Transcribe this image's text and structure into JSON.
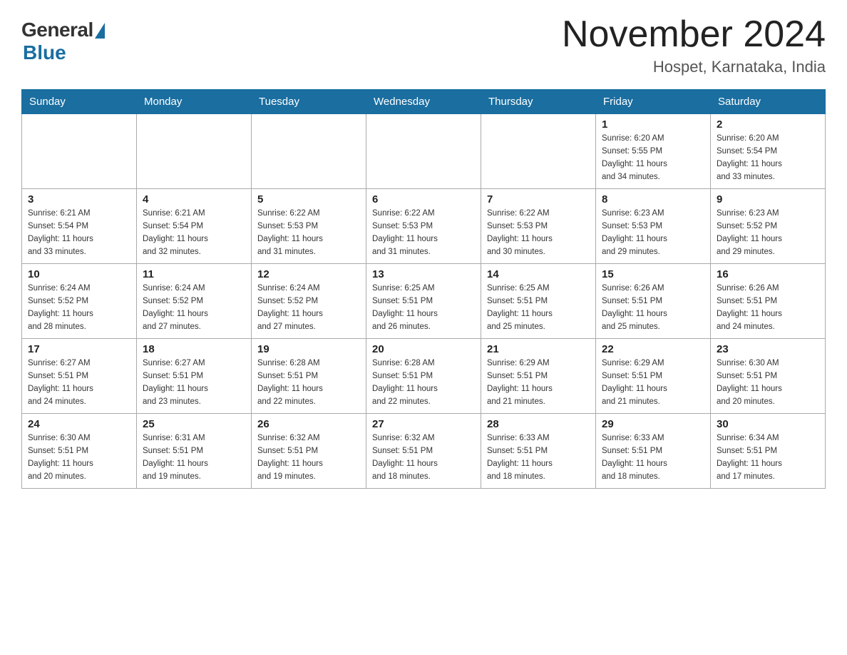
{
  "header": {
    "logo_general": "General",
    "logo_blue": "Blue",
    "month_title": "November 2024",
    "location": "Hospet, Karnataka, India"
  },
  "weekdays": [
    "Sunday",
    "Monday",
    "Tuesday",
    "Wednesday",
    "Thursday",
    "Friday",
    "Saturday"
  ],
  "weeks": [
    [
      {
        "day": "",
        "info": ""
      },
      {
        "day": "",
        "info": ""
      },
      {
        "day": "",
        "info": ""
      },
      {
        "day": "",
        "info": ""
      },
      {
        "day": "",
        "info": ""
      },
      {
        "day": "1",
        "info": "Sunrise: 6:20 AM\nSunset: 5:55 PM\nDaylight: 11 hours\nand 34 minutes."
      },
      {
        "day": "2",
        "info": "Sunrise: 6:20 AM\nSunset: 5:54 PM\nDaylight: 11 hours\nand 33 minutes."
      }
    ],
    [
      {
        "day": "3",
        "info": "Sunrise: 6:21 AM\nSunset: 5:54 PM\nDaylight: 11 hours\nand 33 minutes."
      },
      {
        "day": "4",
        "info": "Sunrise: 6:21 AM\nSunset: 5:54 PM\nDaylight: 11 hours\nand 32 minutes."
      },
      {
        "day": "5",
        "info": "Sunrise: 6:22 AM\nSunset: 5:53 PM\nDaylight: 11 hours\nand 31 minutes."
      },
      {
        "day": "6",
        "info": "Sunrise: 6:22 AM\nSunset: 5:53 PM\nDaylight: 11 hours\nand 31 minutes."
      },
      {
        "day": "7",
        "info": "Sunrise: 6:22 AM\nSunset: 5:53 PM\nDaylight: 11 hours\nand 30 minutes."
      },
      {
        "day": "8",
        "info": "Sunrise: 6:23 AM\nSunset: 5:53 PM\nDaylight: 11 hours\nand 29 minutes."
      },
      {
        "day": "9",
        "info": "Sunrise: 6:23 AM\nSunset: 5:52 PM\nDaylight: 11 hours\nand 29 minutes."
      }
    ],
    [
      {
        "day": "10",
        "info": "Sunrise: 6:24 AM\nSunset: 5:52 PM\nDaylight: 11 hours\nand 28 minutes."
      },
      {
        "day": "11",
        "info": "Sunrise: 6:24 AM\nSunset: 5:52 PM\nDaylight: 11 hours\nand 27 minutes."
      },
      {
        "day": "12",
        "info": "Sunrise: 6:24 AM\nSunset: 5:52 PM\nDaylight: 11 hours\nand 27 minutes."
      },
      {
        "day": "13",
        "info": "Sunrise: 6:25 AM\nSunset: 5:51 PM\nDaylight: 11 hours\nand 26 minutes."
      },
      {
        "day": "14",
        "info": "Sunrise: 6:25 AM\nSunset: 5:51 PM\nDaylight: 11 hours\nand 25 minutes."
      },
      {
        "day": "15",
        "info": "Sunrise: 6:26 AM\nSunset: 5:51 PM\nDaylight: 11 hours\nand 25 minutes."
      },
      {
        "day": "16",
        "info": "Sunrise: 6:26 AM\nSunset: 5:51 PM\nDaylight: 11 hours\nand 24 minutes."
      }
    ],
    [
      {
        "day": "17",
        "info": "Sunrise: 6:27 AM\nSunset: 5:51 PM\nDaylight: 11 hours\nand 24 minutes."
      },
      {
        "day": "18",
        "info": "Sunrise: 6:27 AM\nSunset: 5:51 PM\nDaylight: 11 hours\nand 23 minutes."
      },
      {
        "day": "19",
        "info": "Sunrise: 6:28 AM\nSunset: 5:51 PM\nDaylight: 11 hours\nand 22 minutes."
      },
      {
        "day": "20",
        "info": "Sunrise: 6:28 AM\nSunset: 5:51 PM\nDaylight: 11 hours\nand 22 minutes."
      },
      {
        "day": "21",
        "info": "Sunrise: 6:29 AM\nSunset: 5:51 PM\nDaylight: 11 hours\nand 21 minutes."
      },
      {
        "day": "22",
        "info": "Sunrise: 6:29 AM\nSunset: 5:51 PM\nDaylight: 11 hours\nand 21 minutes."
      },
      {
        "day": "23",
        "info": "Sunrise: 6:30 AM\nSunset: 5:51 PM\nDaylight: 11 hours\nand 20 minutes."
      }
    ],
    [
      {
        "day": "24",
        "info": "Sunrise: 6:30 AM\nSunset: 5:51 PM\nDaylight: 11 hours\nand 20 minutes."
      },
      {
        "day": "25",
        "info": "Sunrise: 6:31 AM\nSunset: 5:51 PM\nDaylight: 11 hours\nand 19 minutes."
      },
      {
        "day": "26",
        "info": "Sunrise: 6:32 AM\nSunset: 5:51 PM\nDaylight: 11 hours\nand 19 minutes."
      },
      {
        "day": "27",
        "info": "Sunrise: 6:32 AM\nSunset: 5:51 PM\nDaylight: 11 hours\nand 18 minutes."
      },
      {
        "day": "28",
        "info": "Sunrise: 6:33 AM\nSunset: 5:51 PM\nDaylight: 11 hours\nand 18 minutes."
      },
      {
        "day": "29",
        "info": "Sunrise: 6:33 AM\nSunset: 5:51 PM\nDaylight: 11 hours\nand 18 minutes."
      },
      {
        "day": "30",
        "info": "Sunrise: 6:34 AM\nSunset: 5:51 PM\nDaylight: 11 hours\nand 17 minutes."
      }
    ]
  ]
}
